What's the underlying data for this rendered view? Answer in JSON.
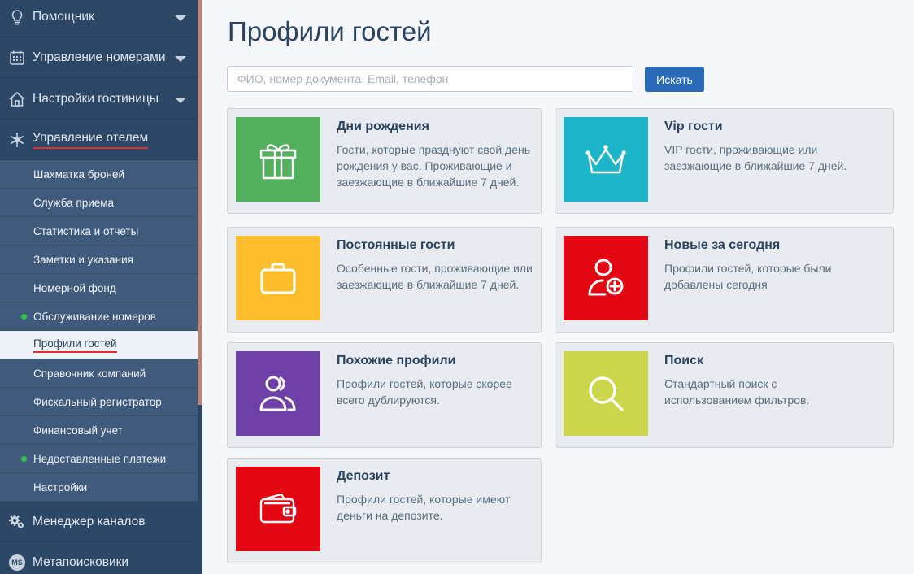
{
  "sidebar": {
    "main_items": {
      "assistant": "Помощник",
      "rooms": "Управление номерами",
      "hotel_settings": "Настройки гостиницы",
      "hotel_management": "Управление отелем",
      "channel_manager": "Менеджер каналов",
      "metasearch": "Метапоисковики",
      "metasearch_badge": "MS"
    },
    "sub_items": [
      {
        "label": "Шахматка броней"
      },
      {
        "label": "Служба приема"
      },
      {
        "label": "Статистика и отчеты"
      },
      {
        "label": "Заметки и указания"
      },
      {
        "label": "Номерной фонд"
      },
      {
        "label": "Обслуживание номеров"
      },
      {
        "label": "Профили гостей"
      },
      {
        "label": "Справочник компаний"
      },
      {
        "label": "Фискальный регистратор"
      },
      {
        "label": "Финансовый учет"
      },
      {
        "label": "Недоставленные платежи"
      },
      {
        "label": "Настройки"
      }
    ]
  },
  "main": {
    "title": "Профили гостей",
    "search": {
      "placeholder": "ФИО, номер документа, Email, телефон",
      "value": "",
      "button_label": "Искать"
    },
    "cards": {
      "birthdays": {
        "title": "Дни рождения",
        "description": "Гости, которые празднуют свой день рождения у вас. Проживающие и заезжающие в ближайшие 7 дней.",
        "color": "#53b15d",
        "icon": "gift-icon"
      },
      "vip": {
        "title": "Vip гости",
        "description": "VIP гости, проживающие или заезжающие в ближайшие 7 дней.",
        "color": "#1fb5c9",
        "icon": "crown-icon"
      },
      "regular": {
        "title": "Постоянные гости",
        "description": "Особенные гости, проживающие или заезжающие в ближайшие 7 дней.",
        "color": "#fcbe2d",
        "icon": "briefcase-icon"
      },
      "new_today": {
        "title": "Новые за сегодня",
        "description": "Профили гостей, которые были добавлены сегодня",
        "color": "#e30613",
        "icon": "add-user-icon"
      },
      "similar": {
        "title": "Похожие профили",
        "description": "Профили гостей, которые скорее всего дублируются.",
        "color": "#6e40a8",
        "icon": "users-icon"
      },
      "search": {
        "title": "Поиск",
        "description": "Стандартный поиск с использованием фильтров.",
        "color": "#ccd64b",
        "icon": "search-icon"
      },
      "deposit": {
        "title": "Депозит",
        "description": "Профили гостей, которые имеют деньги на депозите.",
        "color": "#e30613",
        "icon": "wallet-icon"
      }
    }
  }
}
